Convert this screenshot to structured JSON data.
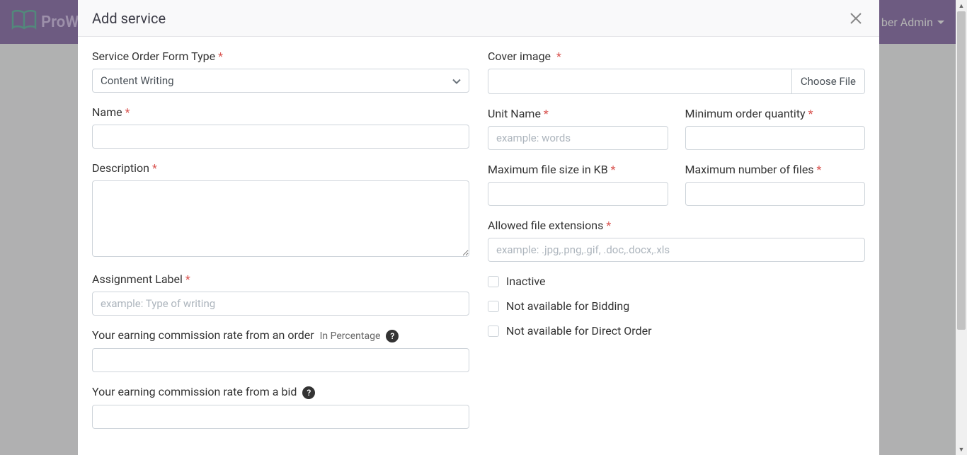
{
  "nav": {
    "brand": "ProW",
    "user_partial": "ber Admin"
  },
  "modal": {
    "title": "Add service",
    "left": {
      "form_type": {
        "label": "Service Order Form Type",
        "value": "Content Writing"
      },
      "name": {
        "label": "Name"
      },
      "description": {
        "label": "Description"
      },
      "assignment_label": {
        "label": "Assignment Label",
        "placeholder": "example: Type of writing"
      },
      "commission_order": {
        "label": "Your earning commission rate from an order",
        "sub": "In Percentage",
        "help": "?"
      },
      "commission_bid": {
        "label": "Your earning commission rate from a bid",
        "help": "?"
      }
    },
    "right": {
      "cover_image": {
        "label": "Cover image",
        "button": "Choose File"
      },
      "unit_name": {
        "label": "Unit Name",
        "placeholder": "example: words"
      },
      "min_qty": {
        "label": "Minimum order quantity"
      },
      "max_file_size": {
        "label": "Maximum file size in KB"
      },
      "max_files": {
        "label": "Maximum number of files"
      },
      "extensions": {
        "label": "Allowed file extensions",
        "placeholder": "example: .jpg,.png,.gif, .doc,.docx,.xls"
      },
      "checks": {
        "inactive": "Inactive",
        "no_bidding": "Not available for Bidding",
        "no_direct": "Not available for Direct Order"
      }
    }
  }
}
